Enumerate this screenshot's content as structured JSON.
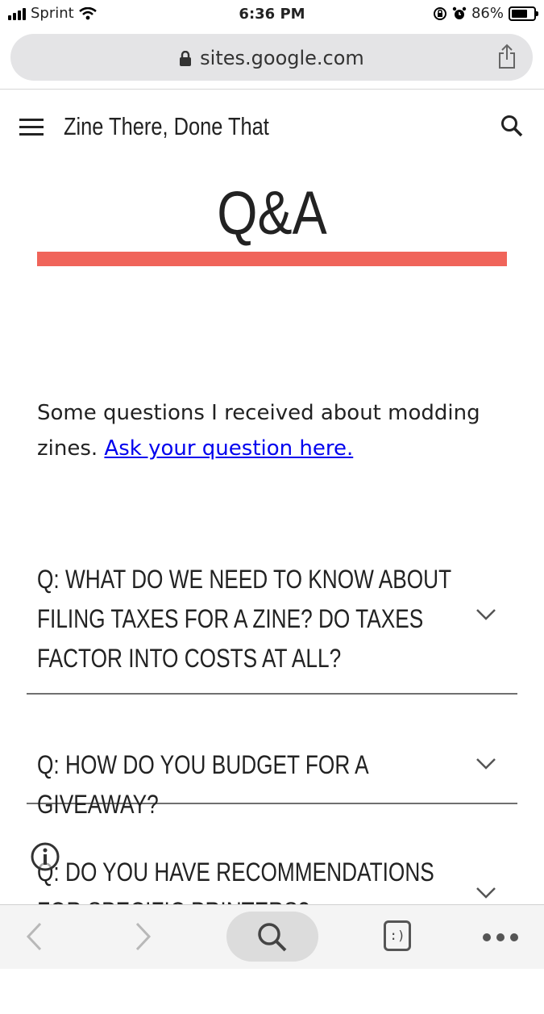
{
  "status_bar": {
    "carrier": "Sprint",
    "time": "6:36 PM",
    "battery": "86%",
    "battery_level": 0.86
  },
  "browser": {
    "url": "sites.google.com"
  },
  "site": {
    "title": "Zine There, Done That"
  },
  "page": {
    "title": "Q&A",
    "intro_text": "Some questions I received about modding zines.",
    "intro_link": "Ask your question here."
  },
  "faq": [
    {
      "question": "Q: WHAT DO WE NEED TO KNOW ABOUT FILING TAXES FOR A ZINE? DO TAXES FACTOR INTO COSTS AT ALL?"
    },
    {
      "question": "Q: HOW DO YOU BUDGET FOR A GIVEAWAY?"
    },
    {
      "question": "Q: DO YOU HAVE RECOMMENDATIONS FOR SPECIFIC PRINTERS?"
    }
  ],
  "toolbar": {
    "icons": [
      "back-icon",
      "forward-icon",
      "search-icon",
      "extension-icon",
      "more-icon"
    ],
    "extension_glyph": ":)"
  },
  "colors": {
    "accent_bar": "#f0645a",
    "link": "#0000ee"
  }
}
